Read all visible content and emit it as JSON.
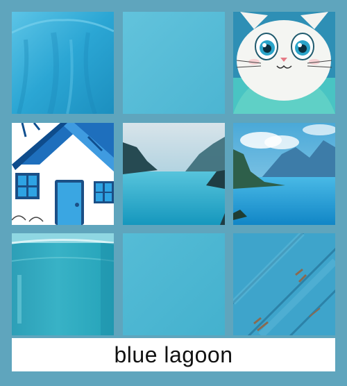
{
  "caption": "blue lagoon",
  "colors": {
    "background": "#5fa5bd",
    "caption_background": "#ffffff",
    "caption_text": "#111111"
  },
  "tiles": [
    {
      "name": "fabric-tile",
      "main_color": "#2fa6d2"
    },
    {
      "name": "solid-swatch-tile",
      "main_color": "#56bcd8"
    },
    {
      "name": "cartoon-cat-tile",
      "main_color": "#3fc2c7"
    },
    {
      "name": "cottage-tile",
      "main_color": "#1e76c0"
    },
    {
      "name": "misty-lake-tile",
      "main_color": "#23a9c6"
    },
    {
      "name": "mountain-lake-tile",
      "main_color": "#2aa2d8"
    },
    {
      "name": "ceramic-cup-tile",
      "main_color": "#2ea9bd"
    },
    {
      "name": "solid-swatch-tile-2",
      "main_color": "#4cb7d3"
    },
    {
      "name": "wood-plank-tile",
      "main_color": "#3a9fc6"
    }
  ]
}
